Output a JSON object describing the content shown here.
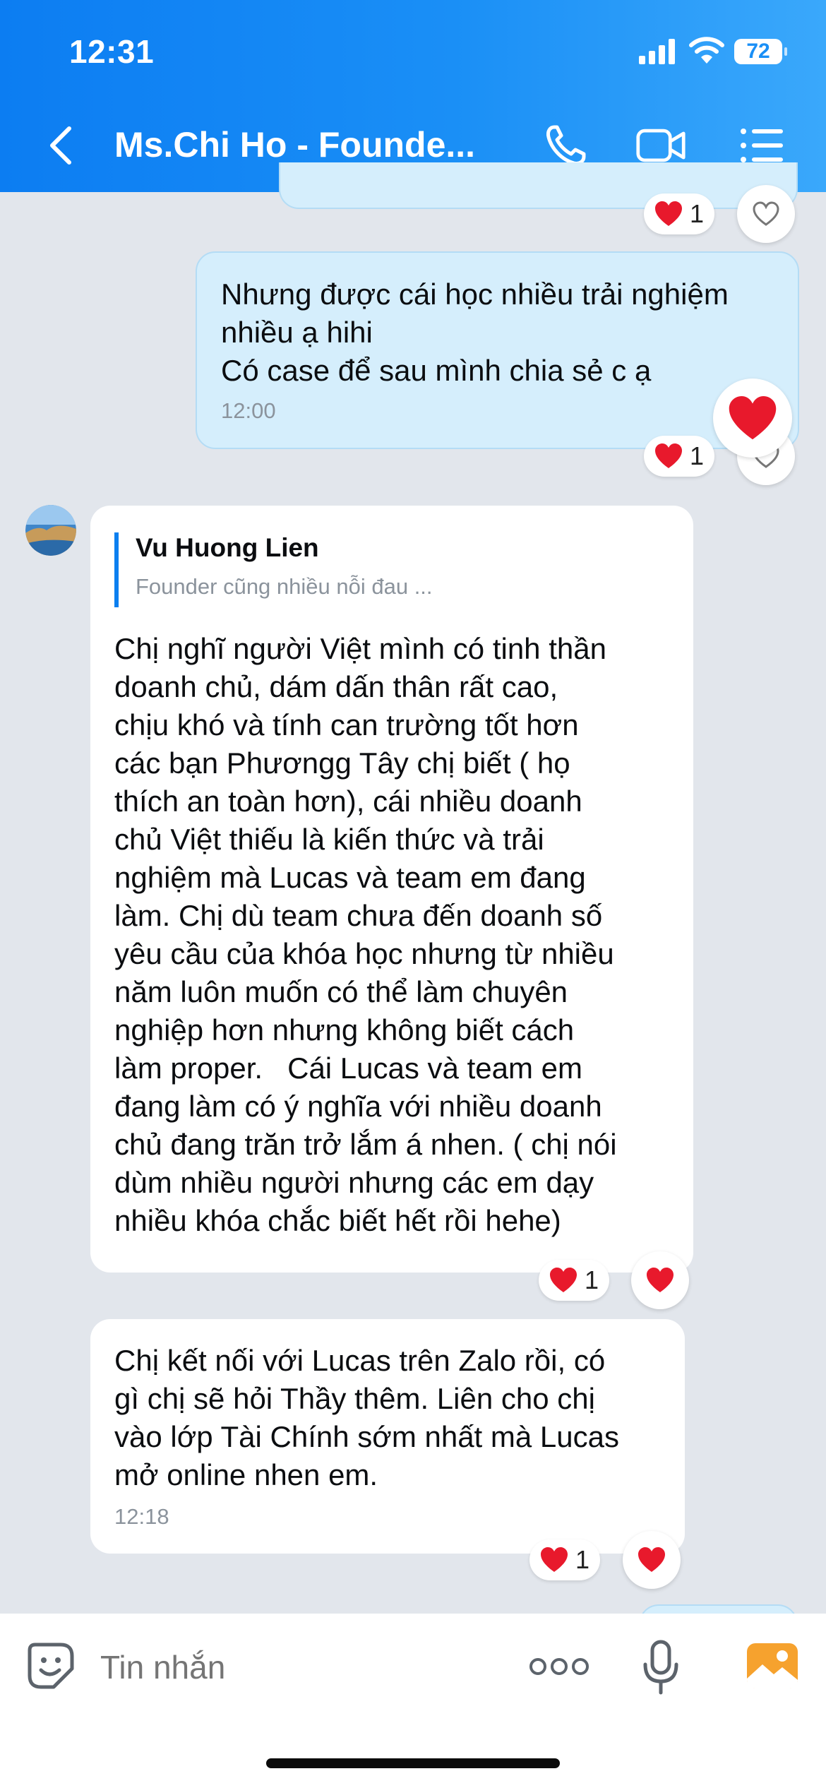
{
  "status": {
    "time": "12:31",
    "battery": "72"
  },
  "header": {
    "title": "Ms.Chi Ho - Founde..."
  },
  "top_reaction": {
    "count": "1"
  },
  "messages": [
    {
      "text": "Nhưng được cái học nhiều trải nghiệm\nnhiều ạ hihi\nCó case để sau mình chia sẻ c ạ",
      "time": "12:00",
      "reaction_count": "1"
    },
    {
      "quote_author": "Vu Huong Lien",
      "quote_text": "Founder cũng nhiều nỗi đau ...",
      "text": "Chị nghĩ người Việt mình có tinh thần\ndoanh chủ, dám dấn thân rất cao,\nchịu khó và tính can trường tốt hơn\ncác bạn Phươngg Tây chị biết ( họ\nthích an toàn hơn), cái nhiều doanh\nchủ Việt thiếu là kiến thức và trải\nnghiệm mà Lucas và team em đang\nlàm. Chị dù team chưa đến doanh số\nyêu cầu của khóa học nhưng từ nhiều\nnăm luôn muốn có thể làm chuyên\nnghiệp hơn nhưng không biết cách\nlàm proper.   Cái Lucas và team em\nđang làm có ý nghĩa với nhiều doanh\nchủ đang trăn trở lắm á nhen. ( chị nói\ndùm nhiều người nhưng các em dạy\nnhiều khóa chắc biết hết rồi hehe)",
      "reaction_count": "1"
    },
    {
      "text": "Chị kết nối với Lucas trên Zalo rồi, có\ngì chị sẽ hỏi Thầy thêm. Liên cho chị\nvào lớp Tài Chính sớm nhất mà Lucas\nmở online nhen em.",
      "time": "12:18",
      "reaction_count": "1"
    }
  ],
  "input": {
    "placeholder": "Tin nhắn"
  },
  "colors": {
    "header_start": "#0c7df2",
    "header_end": "#3aa8fb",
    "heart": "#e8192c",
    "sent_bubble": "#d5eefc"
  }
}
